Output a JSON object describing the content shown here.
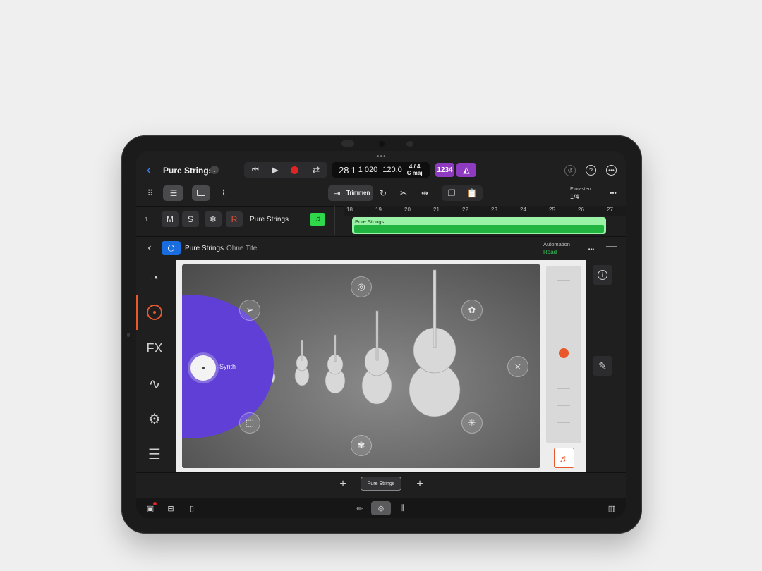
{
  "header": {
    "track_name": "Pure Strings",
    "lcd": {
      "bar": "28",
      "beat": "1",
      "sub": "1 020",
      "tempo": "120,0",
      "sig_top": "4 / 4",
      "sig_bottom": "C maj"
    },
    "count_in": "1234"
  },
  "toolbar": {
    "trim_label": "Trimmen",
    "snap_label": "Einrasten",
    "snap_value": "1/4"
  },
  "track": {
    "number": "1",
    "mute": "M",
    "solo": "S",
    "record": "R",
    "name": "Pure Strings",
    "region_label": "Pure Strings"
  },
  "ruler": [
    "18",
    "19",
    "20",
    "21",
    "22",
    "23",
    "24",
    "25",
    "26",
    "27"
  ],
  "plugin": {
    "name": "Pure Strings",
    "preset": "Ohne Titel",
    "automation_label": "Automation",
    "automation_value": "Read"
  },
  "sidebar": [
    {
      "name": "sampler-icon"
    },
    {
      "name": "play-surface-icon"
    },
    {
      "name": "fx-icon",
      "label": "FX"
    },
    {
      "name": "waveform-icon"
    },
    {
      "name": "settings-icon"
    },
    {
      "name": "list-icon"
    }
  ],
  "synth_label": "Synth",
  "patch": {
    "tab_label": "Pure Strings"
  },
  "colors": {
    "accent": "#5f3fd6",
    "record": "#e02424",
    "region": "#99f2a6",
    "purple": "#8e3bc2",
    "orange": "#e8582b"
  }
}
